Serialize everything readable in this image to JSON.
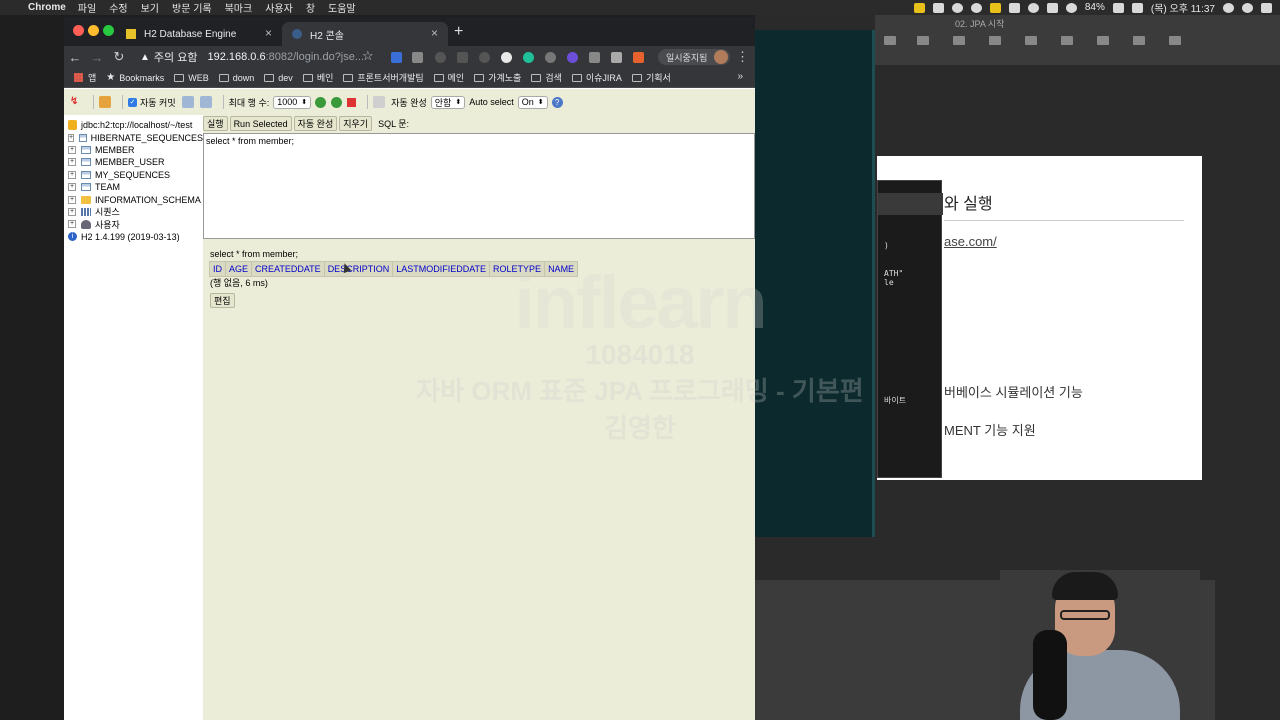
{
  "menubar": {
    "app_name": "Chrome",
    "items": [
      "파일",
      "수정",
      "보기",
      "방문 기록",
      "북마크",
      "사용자",
      "창",
      "도움말"
    ],
    "battery": "84%",
    "datetime": "(목) 오후 11:37"
  },
  "keynote": {
    "doc_title": "02. JPA 시작",
    "slide_title": "와 실행",
    "slide_link": "ase.com/",
    "bullet1": "버베이스 시뮬레이션 기능",
    "bullet2": "MENT 기능 지원",
    "inner_lines": [
      ")",
      "ATH\"",
      "le",
      "바이트"
    ]
  },
  "chrome": {
    "tabs": [
      {
        "label": "H2 Database Engine",
        "active": false
      },
      {
        "label": "H2 콘솔",
        "active": true
      }
    ],
    "address": {
      "warning_label": "주의 요함",
      "host": "192.168.0.6",
      "path": ":8082/login.do?jse..."
    },
    "profile_label": "일시중지됨",
    "bookmarks": [
      "앱",
      "Bookmarks",
      "WEB",
      "down",
      "dev",
      "베인",
      "프론트서버개발팀",
      "메인",
      "가계노출",
      "검색",
      "이슈JIRA",
      "기획서"
    ],
    "bookmarks_more": "»"
  },
  "h2": {
    "toolbar": {
      "auto_commit_label": "자동 커밋",
      "max_rows_label": "최대 행 수:",
      "max_rows_value": "1000",
      "auto_complete_label": "자동 완성",
      "auto_complete_value": "안함",
      "auto_select_label": "Auto select",
      "auto_select_value": "On",
      "help": "?"
    },
    "tree": [
      {
        "label": "jdbc:h2:tcp://localhost/~/test",
        "type": "db"
      },
      {
        "label": "HIBERNATE_SEQUENCES",
        "type": "table"
      },
      {
        "label": "MEMBER",
        "type": "table"
      },
      {
        "label": "MEMBER_USER",
        "type": "table"
      },
      {
        "label": "MY_SEQUENCES",
        "type": "table"
      },
      {
        "label": "TEAM",
        "type": "table"
      },
      {
        "label": "INFORMATION_SCHEMA",
        "type": "folder"
      },
      {
        "label": "시퀀스",
        "type": "sequence"
      },
      {
        "label": "사용자",
        "type": "user"
      },
      {
        "label": "H2 1.4.199 (2019-03-13)",
        "type": "info"
      }
    ],
    "query_buttons": {
      "run": "실행",
      "run_selected": "Run Selected",
      "auto_complete": "자동 완성",
      "clear": "지우기",
      "sql_label": "SQL 문:"
    },
    "sql_text": "select * from member;",
    "result": {
      "query": "select * from member;",
      "columns": [
        "ID",
        "AGE",
        "CREATEDDATE",
        "DESCRIPTION",
        "LASTMODIFIEDDATE",
        "ROLETYPE",
        "NAME"
      ],
      "status": "(행 없음, 6 ms)",
      "edit_label": "편집"
    }
  },
  "watermark": {
    "logo": "inflearn",
    "id": "1084018",
    "course": "자바 ORM 표준 JPA 프로그래밍 - 기본편",
    "author": "김영한"
  },
  "colors": {
    "h2_bg": "#ecedd8",
    "header_link": "#0000cc",
    "terminal_bg": "#0c2a2d"
  }
}
